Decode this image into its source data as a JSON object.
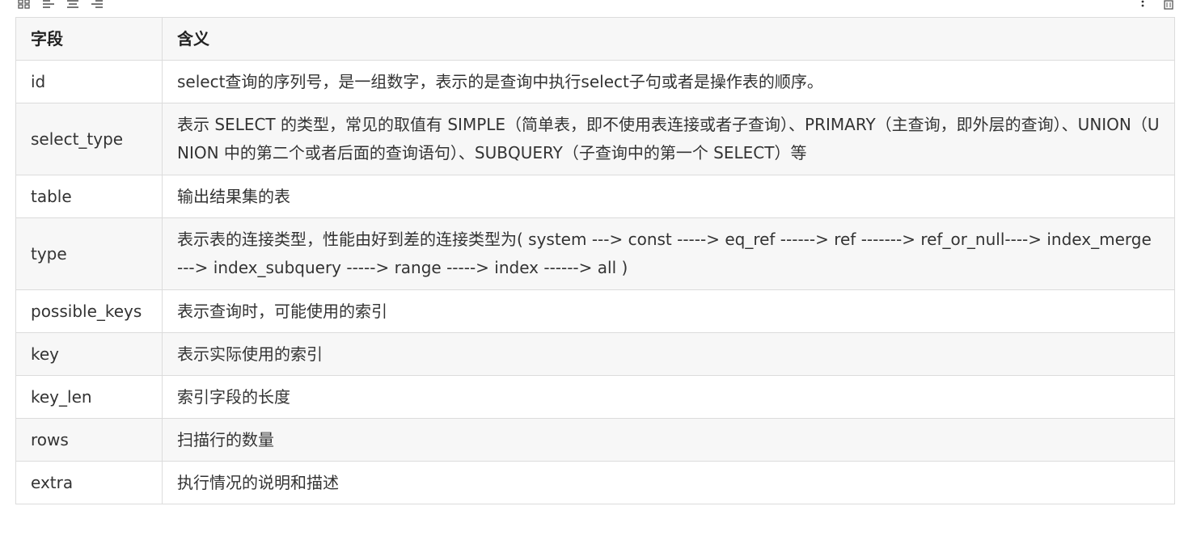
{
  "table": {
    "headers": [
      "字段",
      "含义"
    ],
    "rows": [
      {
        "field": "id",
        "meaning": "select查询的序列号，是一组数字，表示的是查询中执行select子句或者是操作表的顺序。"
      },
      {
        "field": "select_type",
        "meaning": "表示 SELECT 的类型，常见的取值有 SIMPLE（简单表，即不使用表连接或者子查询）、PRIMARY（主查询，即外层的查询）、UNION（UNION 中的第二个或者后面的查询语句）、SUBQUERY（子查询中的第一个 SELECT）等"
      },
      {
        "field": "table",
        "meaning": "输出结果集的表"
      },
      {
        "field": "type",
        "meaning": "表示表的连接类型，性能由好到差的连接类型为( system ---> const -----> eq_ref ------> ref -------> ref_or_null----> index_merge ---> index_subquery -----> range -----> index ------> all )"
      },
      {
        "field": "possible_keys",
        "meaning": "表示查询时，可能使用的索引"
      },
      {
        "field": "key",
        "meaning": "表示实际使用的索引"
      },
      {
        "field": "key_len",
        "meaning": "索引字段的长度"
      },
      {
        "field": "rows",
        "meaning": "扫描行的数量"
      },
      {
        "field": "extra",
        "meaning": "执行情况的说明和描述"
      }
    ]
  },
  "toolbar": {
    "left_icons": [
      "grid-icon",
      "align-left-icon",
      "align-center-icon",
      "align-right-icon"
    ],
    "right_icons": [
      "more-vertical-icon",
      "delete-icon"
    ]
  }
}
